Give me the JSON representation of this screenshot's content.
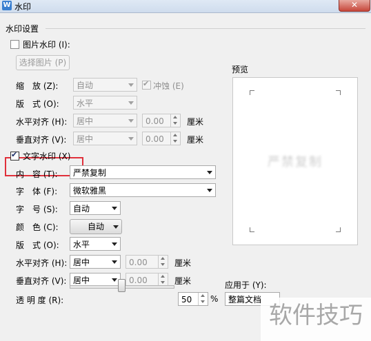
{
  "window": {
    "title": "水印",
    "app_icon": "W",
    "close_glyph": "✕"
  },
  "section": {
    "title": "水印设置"
  },
  "image_wm": {
    "checkbox_label": "图片水印 (I):",
    "checked": false,
    "select_button": "选择图片 (P)",
    "scale_label": "缩　放 (Z):",
    "scale_value": "自动",
    "washout_label": "冲蚀 (E)",
    "washout_checked": true,
    "layout_label": "版　式 (O):",
    "layout_value": "水平",
    "halign_label": "水平对齐 (H):",
    "halign_value": "居中",
    "halign_offset": "0.00",
    "valign_label": "垂直对齐 (V):",
    "valign_value": "居中",
    "valign_offset": "0.00",
    "unit": "厘米"
  },
  "text_wm": {
    "checkbox_label": "文字水印 (X)",
    "checked": true,
    "content_label": "内　容 (T):",
    "content_value": "严禁复制",
    "font_label": "字　体 (F):",
    "font_value": "微软雅黑",
    "size_label": "字　号 (S):",
    "size_value": "自动",
    "color_label": "颜　色 (C):",
    "color_value": "自动",
    "layout_label": "版　式 (O):",
    "layout_value": "水平",
    "halign_label": "水平对齐 (H):",
    "halign_value": "居中",
    "halign_offset": "0.00",
    "valign_label": "垂直对齐 (V):",
    "valign_value": "居中",
    "valign_offset": "0.00",
    "unit": "厘米",
    "opacity_label": "透 明 度 (R):",
    "opacity_value": "50",
    "opacity_unit": "%"
  },
  "preview": {
    "label": "预览",
    "sample_text": "严禁复制"
  },
  "apply": {
    "label": "应用于 (Y):",
    "value": "整篇文档"
  },
  "overlay_logo": "软件技巧",
  "colors": {
    "highlight": "#e0303a",
    "panel": "#f0f0f0"
  }
}
